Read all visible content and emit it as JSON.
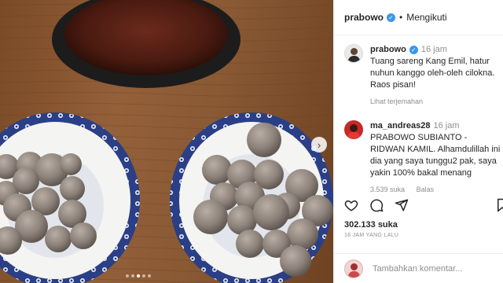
{
  "post": {
    "username": "prabowo",
    "follow_label": "Mengikuti",
    "likes": "302.133 suka",
    "posted_ago": "16 JAM YANG LALU"
  },
  "caption": {
    "username": "prabowo",
    "time": "16 jam",
    "text": "Tuang sareng Kang Emil, hatur nuhun kanggo oleh-oleh cilokna. Raos pisan!",
    "translate_label": "Lihat terjemahan"
  },
  "comments": [
    {
      "username": "ma_andreas28",
      "time": "16 jam",
      "text": "PRABOWO SUBIANTO - RIDWAN KAMIL. Alhamdulillah ini dia yang saya tunggu2 pak, saya yakin 100% bakal menang",
      "likes": "3.539 suka",
      "reply_label": "Balas"
    }
  ],
  "composer": {
    "placeholder": "Tambahkan komentar..."
  },
  "icons": {
    "like": "heart-icon",
    "comment": "comment-icon",
    "share": "send-icon",
    "save": "bookmark-icon",
    "verified": "verified-badge-icon",
    "next": "chevron-right-icon"
  },
  "colors": {
    "verified": "#3897f0",
    "text": "#262626",
    "muted": "#8e8e8e",
    "bowl_rim": "#2a3f86"
  },
  "carousel": {
    "slide_count": 5,
    "active_index": 2
  }
}
